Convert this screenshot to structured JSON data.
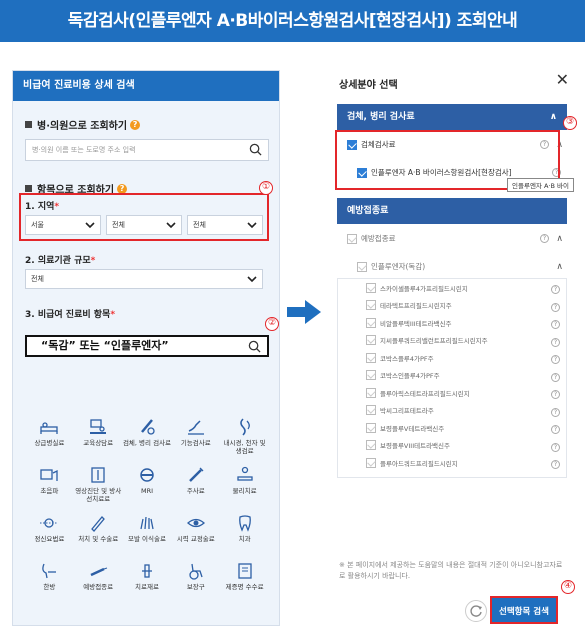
{
  "title": "독감검사(인플루엔자 A·B바이러스항원검사[현장검사]) 조회안내",
  "left": {
    "header": "비급여 진료비용 상세 검색",
    "hospital_label": "병·의원으로 조회하기",
    "hospital_placeholder": "병·의원 이름 또는 도로명 주소 입력",
    "item_label": "항목으로 조회하기",
    "region_label": "1. 지역",
    "region_values": [
      "서울",
      "전체",
      "전체"
    ],
    "scale_label": "2. 의료기관 규모",
    "scale_value": "전체",
    "item3_label": "3. 비급여 진료비 항목",
    "keyword_text": "“독감”  또는  “인플루엔자”",
    "icons": [
      {
        "label": "상급병실료",
        "icon": "bed-icon"
      },
      {
        "label": "교육상담료",
        "icon": "consult-icon"
      },
      {
        "label": "검체, 병리 검사료",
        "icon": "test-tube-icon"
      },
      {
        "label": "기능검사료",
        "icon": "function-test-icon"
      },
      {
        "label": "내시경, 천자 및 생검료",
        "icon": "endoscope-icon"
      },
      {
        "label": "초음파",
        "icon": "ultrasound-icon"
      },
      {
        "label": "영상진단 및 방사선치료료",
        "icon": "xray-icon"
      },
      {
        "label": "MRI",
        "icon": "mri-icon"
      },
      {
        "label": "주사료",
        "icon": "syringe-icon"
      },
      {
        "label": "물리치료",
        "icon": "physio-icon"
      },
      {
        "label": "정신요법료",
        "icon": "brain-icon"
      },
      {
        "label": "처치 및 수술료",
        "icon": "surgery-icon"
      },
      {
        "label": "모발 이식술료",
        "icon": "hair-icon"
      },
      {
        "label": "시력 교정술료",
        "icon": "eye-icon"
      },
      {
        "label": "치과",
        "icon": "tooth-icon"
      },
      {
        "label": "한방",
        "icon": "herbal-icon"
      },
      {
        "label": "예방접종료",
        "icon": "vaccine-icon"
      },
      {
        "label": "치료재료",
        "icon": "material-icon"
      },
      {
        "label": "보장구",
        "icon": "wheelchair-icon"
      },
      {
        "label": "제증명 수수료",
        "icon": "certificate-icon"
      }
    ]
  },
  "right": {
    "title": "상세분야 선택",
    "group1": "검체, 병리 검사료",
    "row1": "검체검사료",
    "row2": "인플루엔자 A·B 바이러스항원검사[현장검사]",
    "tooltip": "인플루엔자 A·B 바이",
    "group2": "예방접종료",
    "row3": "예방접종료",
    "row4": "인플루엔자(독감)",
    "list": [
      "스카이셀플루4가프리필드시린지",
      "테라텍트프리필드시린지주",
      "비알플루텍III테트라백신주",
      "지씨플루쿼드리밸런트프리필드시린지주",
      "코박스플루4가PF주",
      "코박스인플루4가PF주",
      "플루아릭스테트라프리필드시린지",
      "박씨그리프테트라주",
      "보령플루V테트라백신주",
      "보령플루VIII테트라백신주",
      "플루아드쿼드프리필드시린지"
    ],
    "note": "※ 본 페이지에서 제공하는 도움말의 내용은 절대적 기준이 아니오니참고자료로 활용하시기 바랍니다.",
    "search_button": "선택항목 검색"
  },
  "markers": [
    "①",
    "②",
    "③",
    "④"
  ],
  "colors": {
    "brand": "#1f6fbf",
    "group": "#2d5fa5",
    "highlight": "#e3262a",
    "question": "#f39a1e"
  }
}
